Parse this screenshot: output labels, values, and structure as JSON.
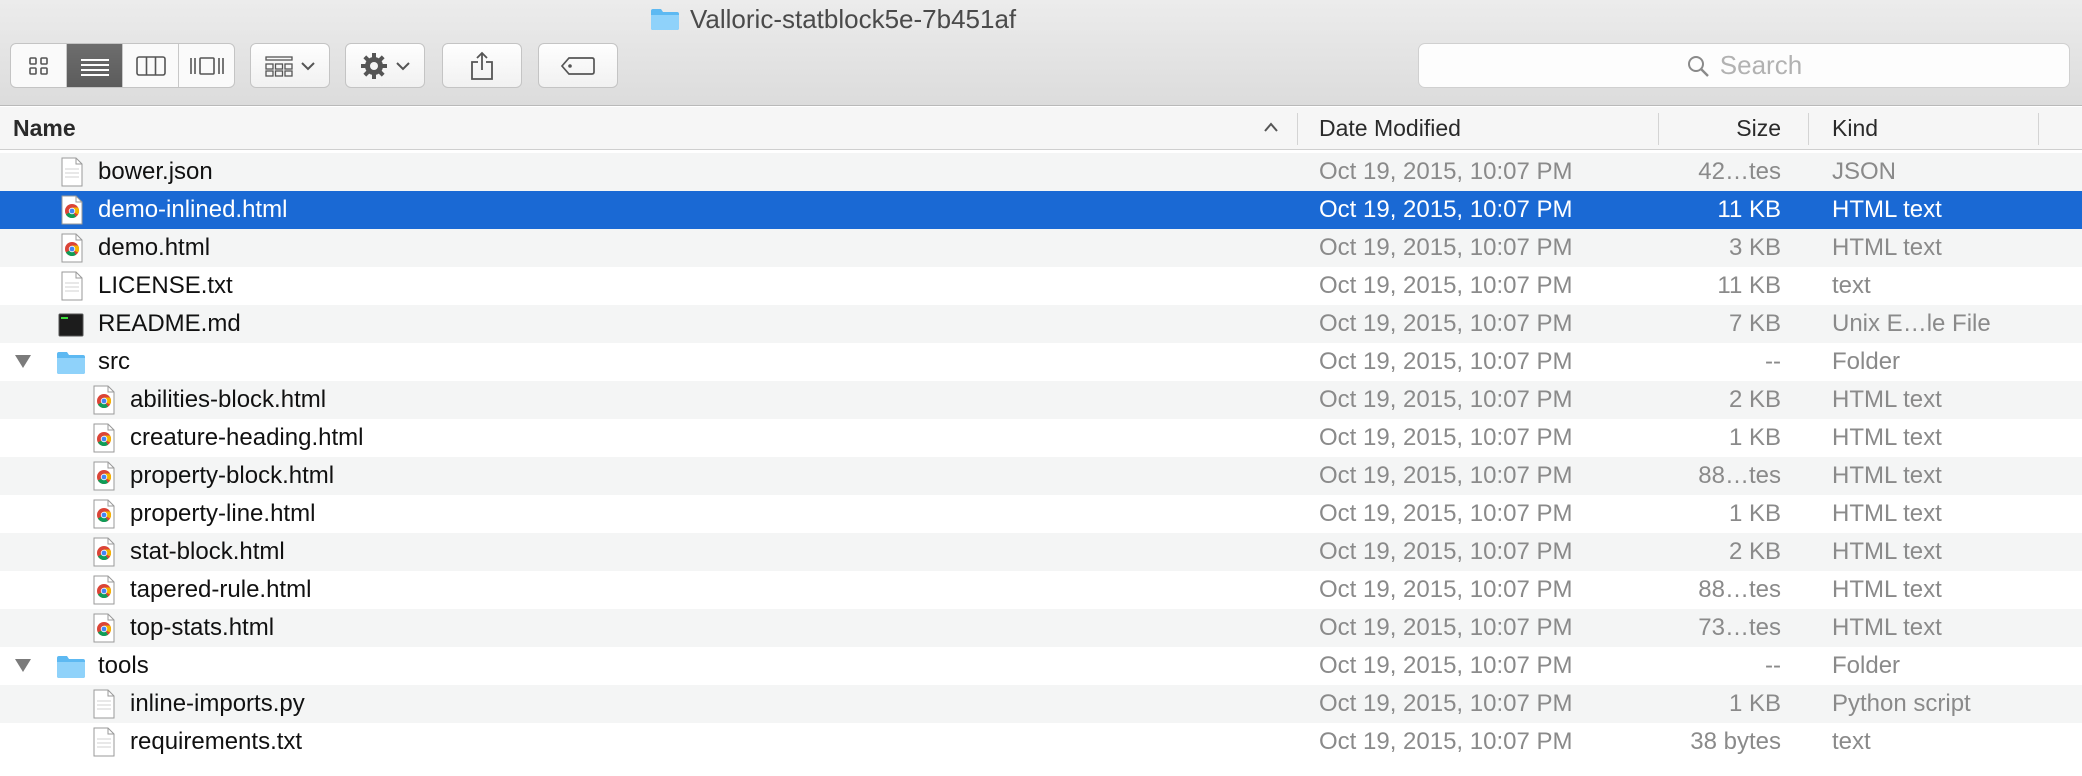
{
  "window": {
    "title": "Valloric-statblock5e-7b451af"
  },
  "toolbar": {
    "view_modes": [
      "icon-view",
      "list-view",
      "column-view",
      "cover-flow-view"
    ],
    "active_view": "list-view",
    "search_placeholder": "Search"
  },
  "columns": {
    "name": "Name",
    "date": "Date Modified",
    "size": "Size",
    "kind": "Kind"
  },
  "colors": {
    "selection": "#1a69d4",
    "folder": "#5db9f2",
    "alt_row": "#f4f5f5"
  },
  "files": [
    {
      "name": "bower.json",
      "date": "Oct 19, 2015, 10:07 PM",
      "size": "42…tes",
      "kind": "JSON",
      "icon": "document-icon",
      "indent": 0
    },
    {
      "name": "demo-inlined.html",
      "date": "Oct 19, 2015, 10:07 PM",
      "size": "11 KB",
      "kind": "HTML text",
      "icon": "chrome-html-icon",
      "indent": 0,
      "selected": true
    },
    {
      "name": "demo.html",
      "date": "Oct 19, 2015, 10:07 PM",
      "size": "3 KB",
      "kind": "HTML text",
      "icon": "chrome-html-icon",
      "indent": 0
    },
    {
      "name": "LICENSE.txt",
      "date": "Oct 19, 2015, 10:07 PM",
      "size": "11 KB",
      "kind": "text",
      "icon": "document-icon",
      "indent": 0
    },
    {
      "name": "README.md",
      "date": "Oct 19, 2015, 10:07 PM",
      "size": "7 KB",
      "kind": "Unix E…le File",
      "icon": "terminal-icon",
      "indent": 0
    },
    {
      "name": "src",
      "date": "Oct 19, 2015, 10:07 PM",
      "size": "--",
      "kind": "Folder",
      "icon": "folder-icon",
      "indent": 0,
      "expanded": true
    },
    {
      "name": "abilities-block.html",
      "date": "Oct 19, 2015, 10:07 PM",
      "size": "2 KB",
      "kind": "HTML text",
      "icon": "chrome-html-icon",
      "indent": 1
    },
    {
      "name": "creature-heading.html",
      "date": "Oct 19, 2015, 10:07 PM",
      "size": "1 KB",
      "kind": "HTML text",
      "icon": "chrome-html-icon",
      "indent": 1
    },
    {
      "name": "property-block.html",
      "date": "Oct 19, 2015, 10:07 PM",
      "size": "88…tes",
      "kind": "HTML text",
      "icon": "chrome-html-icon",
      "indent": 1
    },
    {
      "name": "property-line.html",
      "date": "Oct 19, 2015, 10:07 PM",
      "size": "1 KB",
      "kind": "HTML text",
      "icon": "chrome-html-icon",
      "indent": 1
    },
    {
      "name": "stat-block.html",
      "date": "Oct 19, 2015, 10:07 PM",
      "size": "2 KB",
      "kind": "HTML text",
      "icon": "chrome-html-icon",
      "indent": 1
    },
    {
      "name": "tapered-rule.html",
      "date": "Oct 19, 2015, 10:07 PM",
      "size": "88…tes",
      "kind": "HTML text",
      "icon": "chrome-html-icon",
      "indent": 1
    },
    {
      "name": "top-stats.html",
      "date": "Oct 19, 2015, 10:07 PM",
      "size": "73…tes",
      "kind": "HTML text",
      "icon": "chrome-html-icon",
      "indent": 1
    },
    {
      "name": "tools",
      "date": "Oct 19, 2015, 10:07 PM",
      "size": "--",
      "kind": "Folder",
      "icon": "folder-icon",
      "indent": 0,
      "expanded": true
    },
    {
      "name": "inline-imports.py",
      "date": "Oct 19, 2015, 10:07 PM",
      "size": "1 KB",
      "kind": "Python script",
      "icon": "document-icon",
      "indent": 1
    },
    {
      "name": "requirements.txt",
      "date": "Oct 19, 2015, 10:07 PM",
      "size": "38 bytes",
      "kind": "text",
      "icon": "document-icon",
      "indent": 1
    }
  ]
}
